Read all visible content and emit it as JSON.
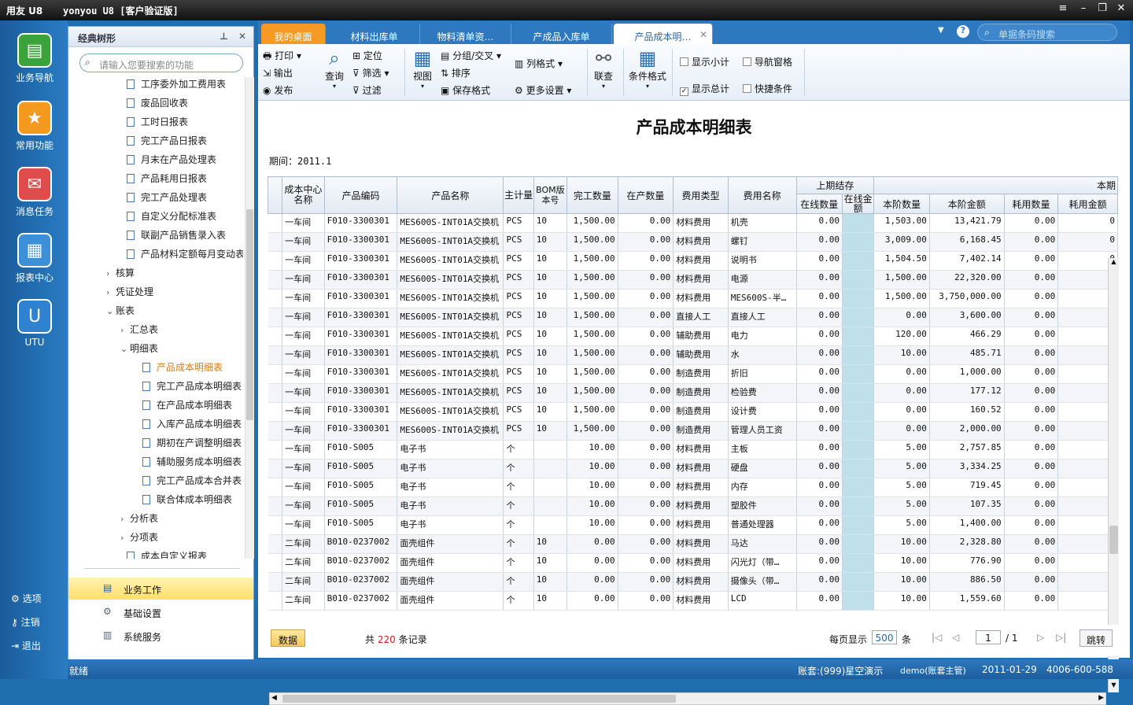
{
  "titlebar": {
    "logo": "用友 U8",
    "title": "yonyou U8 [客户验证版]"
  },
  "leftnav": {
    "items": [
      "业务导航",
      "常用功能",
      "消息任务",
      "报表中心",
      "UTU"
    ],
    "links": [
      "选项",
      "注销",
      "退出"
    ]
  },
  "panel": {
    "title": "经典树形",
    "search_placeholder": "请输入您要搜索的功能",
    "tree": [
      {
        "label": "工序委外加工费用表",
        "kind": "doc",
        "level": 3
      },
      {
        "label": "废品回收表",
        "kind": "doc",
        "level": 3
      },
      {
        "label": "工时日报表",
        "kind": "doc",
        "level": 3
      },
      {
        "label": "完工产品日报表",
        "kind": "doc",
        "level": 3
      },
      {
        "label": "月末在产品处理表",
        "kind": "doc",
        "level": 3
      },
      {
        "label": "产品耗用日报表",
        "kind": "doc",
        "level": 3
      },
      {
        "label": "完工产品处理表",
        "kind": "doc",
        "level": 3
      },
      {
        "label": "自定义分配标准表",
        "kind": "doc",
        "level": 3
      },
      {
        "label": "联副产品销售录入表",
        "kind": "doc",
        "level": 3
      },
      {
        "label": "产品材料定额每月变动表",
        "kind": "doc",
        "level": 3
      },
      {
        "label": "核算",
        "kind": "fold",
        "level": 2,
        "arrow": "›"
      },
      {
        "label": "凭证处理",
        "kind": "fold",
        "level": 2,
        "arrow": "›"
      },
      {
        "label": "账表",
        "kind": "fold",
        "level": 2,
        "arrow": "⌄"
      },
      {
        "label": "汇总表",
        "kind": "fold",
        "level": 3,
        "arrow": "›"
      },
      {
        "label": "明细表",
        "kind": "fold",
        "level": 3,
        "arrow": "⌄"
      },
      {
        "label": "产品成本明细表",
        "kind": "doc",
        "level": 4,
        "selected": true
      },
      {
        "label": "完工产品成本明细表",
        "kind": "doc",
        "level": 4
      },
      {
        "label": "在产品成本明细表",
        "kind": "doc",
        "level": 4
      },
      {
        "label": "入库产品成本明细表",
        "kind": "doc",
        "level": 4
      },
      {
        "label": "期初在产调整明细表",
        "kind": "doc",
        "level": 4
      },
      {
        "label": "辅助服务成本明细表",
        "kind": "doc",
        "level": 4
      },
      {
        "label": "完工产品成本合并表",
        "kind": "doc",
        "level": 4
      },
      {
        "label": "联合体成本明细表",
        "kind": "doc",
        "level": 4
      },
      {
        "label": "分析表",
        "kind": "fold",
        "level": 3,
        "arrow": "›"
      },
      {
        "label": "分项表",
        "kind": "fold",
        "level": 3,
        "arrow": "›"
      },
      {
        "label": "成本自定义报表",
        "kind": "doc",
        "level": 3
      }
    ],
    "bottom": [
      "业务工作",
      "基础设置",
      "系统服务"
    ]
  },
  "tabs": [
    "我的桌面",
    "材料出库单",
    "物料清单资…",
    "产成品入库单",
    "产品成本明…"
  ],
  "search_bar_placeholder": "单据条码搜索",
  "toolbar": {
    "print": "打印",
    "output": "输出",
    "publish": "发布",
    "query": "查询",
    "locate": "定位",
    "filter": "筛选",
    "filter2": "过滤",
    "view": "视图",
    "group": "分组/交叉",
    "sort": "排序",
    "save_format": "保存格式",
    "column_format": "列格式",
    "more": "更多设置",
    "link": "联查",
    "cond_format": "条件格式",
    "show_subtotal": "显示小计",
    "show_total": "显示总计",
    "nav_pane": "导航窗格",
    "quick_cond": "快捷条件"
  },
  "report": {
    "title": "产品成本明细表",
    "period": "期间：2011.1",
    "group_headers": {
      "prev": "上期结存",
      "curr": "本期"
    },
    "headers": [
      "成本中心名称",
      "产品编码",
      "产品名称",
      "主计量",
      "BOM版本号",
      "完工数量",
      "在产数量",
      "费用类型",
      "费用名称",
      "在线数量",
      "在线金额",
      "本阶数量",
      "本阶金额",
      "耗用数量",
      "耗用金额"
    ],
    "rows": [
      [
        "一车间",
        "F010-3300301",
        "MES600S-INT01A交换机",
        "PCS",
        "10",
        "1,500.00",
        "0.00",
        "材料费用",
        "机壳",
        "0.00",
        "",
        "1,503.00",
        "13,421.79",
        "0.00",
        "0"
      ],
      [
        "一车间",
        "F010-3300301",
        "MES600S-INT01A交换机",
        "PCS",
        "10",
        "1,500.00",
        "0.00",
        "材料费用",
        "螺钉",
        "0.00",
        "",
        "3,009.00",
        "6,168.45",
        "0.00",
        "0"
      ],
      [
        "一车间",
        "F010-3300301",
        "MES600S-INT01A交换机",
        "PCS",
        "10",
        "1,500.00",
        "0.00",
        "材料费用",
        "说明书",
        "0.00",
        "",
        "1,504.50",
        "7,402.14",
        "0.00",
        "0"
      ],
      [
        "一车间",
        "F010-3300301",
        "MES600S-INT01A交换机",
        "PCS",
        "10",
        "1,500.00",
        "0.00",
        "材料费用",
        "电源",
        "0.00",
        "",
        "1,500.00",
        "22,320.00",
        "0.00",
        "0"
      ],
      [
        "一车间",
        "F010-3300301",
        "MES600S-INT01A交换机",
        "PCS",
        "10",
        "1,500.00",
        "0.00",
        "材料费用",
        "MES600S-半…",
        "0.00",
        "",
        "1,500.00",
        "3,750,000.00",
        "0.00",
        "0"
      ],
      [
        "一车间",
        "F010-3300301",
        "MES600S-INT01A交换机",
        "PCS",
        "10",
        "1,500.00",
        "0.00",
        "直接人工",
        "直接人工",
        "0.00",
        "",
        "0.00",
        "3,600.00",
        "0.00",
        "0"
      ],
      [
        "一车间",
        "F010-3300301",
        "MES600S-INT01A交换机",
        "PCS",
        "10",
        "1,500.00",
        "0.00",
        "辅助费用",
        "电力",
        "0.00",
        "",
        "120.00",
        "466.29",
        "0.00",
        "0"
      ],
      [
        "一车间",
        "F010-3300301",
        "MES600S-INT01A交换机",
        "PCS",
        "10",
        "1,500.00",
        "0.00",
        "辅助费用",
        "水",
        "0.00",
        "",
        "10.00",
        "485.71",
        "0.00",
        "0"
      ],
      [
        "一车间",
        "F010-3300301",
        "MES600S-INT01A交换机",
        "PCS",
        "10",
        "1,500.00",
        "0.00",
        "制造费用",
        "折旧",
        "0.00",
        "",
        "0.00",
        "1,000.00",
        "0.00",
        "0"
      ],
      [
        "一车间",
        "F010-3300301",
        "MES600S-INT01A交换机",
        "PCS",
        "10",
        "1,500.00",
        "0.00",
        "制造费用",
        "检验费",
        "0.00",
        "",
        "0.00",
        "177.12",
        "0.00",
        "0"
      ],
      [
        "一车间",
        "F010-3300301",
        "MES600S-INT01A交换机",
        "PCS",
        "10",
        "1,500.00",
        "0.00",
        "制造费用",
        "设计费",
        "0.00",
        "",
        "0.00",
        "160.52",
        "0.00",
        "0"
      ],
      [
        "一车间",
        "F010-3300301",
        "MES600S-INT01A交换机",
        "PCS",
        "10",
        "1,500.00",
        "0.00",
        "制造费用",
        "管理人员工资",
        "0.00",
        "",
        "0.00",
        "2,000.00",
        "0.00",
        "0"
      ],
      [
        "一车间",
        "F010-S005",
        "电子书",
        "个",
        "",
        "10.00",
        "0.00",
        "材料费用",
        "主板",
        "0.00",
        "",
        "5.00",
        "2,757.85",
        "0.00",
        "0"
      ],
      [
        "一车间",
        "F010-S005",
        "电子书",
        "个",
        "",
        "10.00",
        "0.00",
        "材料费用",
        "硬盘",
        "0.00",
        "",
        "5.00",
        "3,334.25",
        "0.00",
        "0"
      ],
      [
        "一车间",
        "F010-S005",
        "电子书",
        "个",
        "",
        "10.00",
        "0.00",
        "材料费用",
        "内存",
        "0.00",
        "",
        "5.00",
        "719.45",
        "0.00",
        "0"
      ],
      [
        "一车间",
        "F010-S005",
        "电子书",
        "个",
        "",
        "10.00",
        "0.00",
        "材料费用",
        "塑胶件",
        "0.00",
        "",
        "5.00",
        "107.35",
        "0.00",
        "0"
      ],
      [
        "一车间",
        "F010-S005",
        "电子书",
        "个",
        "",
        "10.00",
        "0.00",
        "材料费用",
        "普通处理器",
        "0.00",
        "",
        "5.00",
        "1,400.00",
        "0.00",
        "0"
      ],
      [
        "二车间",
        "B010-0237002",
        "面壳组件",
        "个",
        "10",
        "0.00",
        "0.00",
        "材料费用",
        "马达",
        "0.00",
        "",
        "10.00",
        "2,328.80",
        "0.00",
        "0"
      ],
      [
        "二车间",
        "B010-0237002",
        "面壳组件",
        "个",
        "10",
        "0.00",
        "0.00",
        "材料费用",
        "闪光灯（带…",
        "0.00",
        "",
        "10.00",
        "776.90",
        "0.00",
        "0"
      ],
      [
        "二车间",
        "B010-0237002",
        "面壳组件",
        "个",
        "10",
        "0.00",
        "0.00",
        "材料费用",
        "摄像头（带…",
        "0.00",
        "",
        "10.00",
        "886.50",
        "0.00",
        "0"
      ],
      [
        "二车间",
        "B010-0237002",
        "面壳组件",
        "个",
        "10",
        "0.00",
        "0.00",
        "材料费用",
        "LCD",
        "0.00",
        "",
        "10.00",
        "1,559.60",
        "0.00",
        "0"
      ]
    ]
  },
  "pager": {
    "data_btn": "数据",
    "total_prefix": "共",
    "total": "220",
    "total_suffix": "条记录",
    "per_page_label": "每页显示",
    "per_page": "500",
    "per_page_unit": "条",
    "page": "1",
    "pages": "/ 1",
    "jump": "跳转"
  },
  "status": {
    "ready": "就绪",
    "account": "账套:(999)星空演示",
    "user": "demo(账套主管)",
    "date": "2011-01-29",
    "phone": "4006-600-588"
  },
  "colors": {
    "accent": "#f7941d",
    "nav": "#1f6fb0",
    "highlight": "#bfe0ea"
  }
}
